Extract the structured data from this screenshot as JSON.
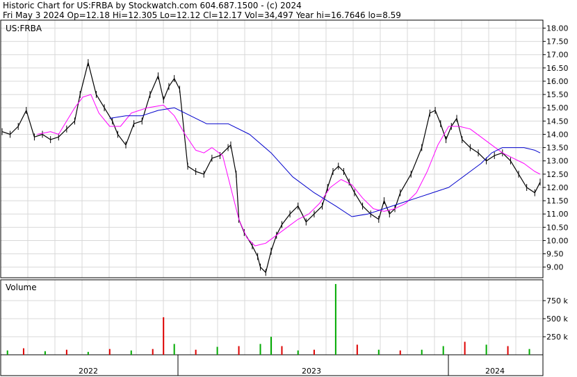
{
  "header": {
    "line1": "Historic Chart for US:FRBA by Stockwatch.com 604.687.1500 - (c) 2024",
    "line2": "Fri May  3 2024   Op=12.18   Hi=12.305   Lo=12.12   Cl=12.17   Vol=34,497   Year hi=16.7646   lo=8.59"
  },
  "chart_data": {
    "type": "line",
    "symbol_label": "US:FRBA",
    "volume_label": "Volume",
    "x_axis_labels": [
      "2022",
      "2023",
      "2024"
    ],
    "price_axis": {
      "ylim": [
        8.6,
        18.3
      ],
      "ticks": [
        "18.00",
        "17.50",
        "17.00",
        "16.50",
        "16.00",
        "15.50",
        "15.00",
        "14.50",
        "14.00",
        "13.50",
        "13.00",
        "12.50",
        "12.00",
        "11.50",
        "11.00",
        "10.50",
        "10.00",
        "9.50",
        "9.00"
      ]
    },
    "volume_axis": {
      "ylim": [
        0,
        1000000
      ],
      "ticks": [
        "750 k",
        "500 k",
        "250 k"
      ]
    },
    "grid": true,
    "colors": {
      "price_bars": "#000000",
      "ma_short": "#ff00ff",
      "ma_long": "#0000cc",
      "volume_up": "#00aa00",
      "volume_down": "#dd0000",
      "grid": "#d8d8d8"
    },
    "series": [
      {
        "kind": "price",
        "x": [
          0,
          0.015,
          0.03,
          0.045,
          0.06,
          0.075,
          0.09,
          0.105,
          0.12,
          0.135,
          0.145,
          0.16,
          0.175,
          0.19,
          0.205,
          0.215,
          0.23,
          0.245,
          0.26,
          0.275,
          0.29,
          0.3,
          0.31,
          0.32,
          0.33,
          0.345,
          0.36,
          0.375,
          0.39,
          0.405,
          0.42,
          0.425,
          0.435,
          0.44,
          0.45,
          0.465,
          0.475,
          0.48,
          0.49,
          0.5,
          0.51,
          0.52,
          0.535,
          0.55,
          0.565,
          0.58,
          0.595,
          0.605,
          0.615,
          0.625,
          0.635,
          0.645,
          0.655,
          0.67,
          0.685,
          0.7,
          0.71,
          0.72,
          0.73,
          0.74,
          0.76,
          0.78,
          0.795,
          0.805,
          0.815,
          0.825,
          0.835,
          0.845,
          0.855,
          0.87,
          0.885,
          0.9,
          0.915,
          0.93,
          0.945,
          0.96,
          0.975,
          0.99,
          1.0
        ],
        "values": [
          14.1,
          14.0,
          14.3,
          14.9,
          13.9,
          14.0,
          13.8,
          13.9,
          14.2,
          14.5,
          15.5,
          16.7,
          15.5,
          15.0,
          14.5,
          14.0,
          13.6,
          14.4,
          14.5,
          15.5,
          16.2,
          15.3,
          15.8,
          16.1,
          15.7,
          12.8,
          12.6,
          12.5,
          13.1,
          13.2,
          13.5,
          13.6,
          12.5,
          10.8,
          10.3,
          9.8,
          9.4,
          9.0,
          8.8,
          9.6,
          10.2,
          10.6,
          11.0,
          11.3,
          10.7,
          11.0,
          11.3,
          12.0,
          12.6,
          12.8,
          12.6,
          12.2,
          11.8,
          11.3,
          11.0,
          10.8,
          11.5,
          11.0,
          11.2,
          11.8,
          12.5,
          13.5,
          14.8,
          14.9,
          14.4,
          13.8,
          14.3,
          14.6,
          13.8,
          13.5,
          13.3,
          13.0,
          13.2,
          13.3,
          13.0,
          12.5,
          12.0,
          11.8,
          12.2
        ]
      },
      {
        "kind": "ma_short",
        "x": [
          0.065,
          0.09,
          0.105,
          0.12,
          0.135,
          0.15,
          0.165,
          0.18,
          0.2,
          0.22,
          0.24,
          0.27,
          0.3,
          0.32,
          0.34,
          0.36,
          0.375,
          0.39,
          0.41,
          0.425,
          0.44,
          0.455,
          0.47,
          0.49,
          0.51,
          0.53,
          0.55,
          0.57,
          0.59,
          0.61,
          0.63,
          0.65,
          0.67,
          0.69,
          0.71,
          0.73,
          0.75,
          0.77,
          0.79,
          0.81,
          0.83,
          0.85,
          0.87,
          0.89,
          0.91,
          0.93,
          0.95,
          0.97,
          0.99,
          1.0
        ],
        "values": [
          14.0,
          14.1,
          14.0,
          14.5,
          15.0,
          15.4,
          15.5,
          14.8,
          14.3,
          14.3,
          14.8,
          15.0,
          15.1,
          14.7,
          14.0,
          13.4,
          13.3,
          13.5,
          13.2,
          12.0,
          10.8,
          10.1,
          9.8,
          9.9,
          10.2,
          10.5,
          10.8,
          11.0,
          11.4,
          12.0,
          12.3,
          12.1,
          11.6,
          11.2,
          11.1,
          11.2,
          11.4,
          11.8,
          12.6,
          13.6,
          14.3,
          14.3,
          14.2,
          13.9,
          13.6,
          13.3,
          13.1,
          12.9,
          12.6,
          12.5
        ]
      },
      {
        "kind": "ma_long",
        "x": [
          0.2,
          0.23,
          0.26,
          0.29,
          0.32,
          0.35,
          0.38,
          0.42,
          0.46,
          0.5,
          0.54,
          0.58,
          0.62,
          0.65,
          0.68,
          0.71,
          0.74,
          0.77,
          0.8,
          0.83,
          0.85,
          0.87,
          0.89,
          0.91,
          0.93,
          0.95,
          0.97,
          0.99,
          1.0
        ],
        "values": [
          14.6,
          14.7,
          14.7,
          14.9,
          15.0,
          14.7,
          14.4,
          14.4,
          14.0,
          13.3,
          12.4,
          11.8,
          11.3,
          10.9,
          11.0,
          11.2,
          11.4,
          11.6,
          11.8,
          12.0,
          12.3,
          12.6,
          12.9,
          13.3,
          13.5,
          13.5,
          13.5,
          13.4,
          13.3
        ]
      }
    ],
    "volume_series": {
      "x": [
        0.01,
        0.04,
        0.08,
        0.12,
        0.16,
        0.2,
        0.24,
        0.28,
        0.3,
        0.32,
        0.36,
        0.4,
        0.44,
        0.48,
        0.5,
        0.52,
        0.55,
        0.58,
        0.62,
        0.66,
        0.7,
        0.74,
        0.78,
        0.82,
        0.86,
        0.9,
        0.94,
        0.98
      ],
      "values": [
        60000,
        90000,
        50000,
        70000,
        40000,
        80000,
        60000,
        80000,
        520000,
        150000,
        70000,
        110000,
        120000,
        150000,
        250000,
        120000,
        60000,
        70000,
        980000,
        140000,
        70000,
        60000,
        70000,
        120000,
        180000,
        140000,
        120000,
        80000
      ],
      "up": [
        true,
        false,
        true,
        false,
        true,
        false,
        true,
        false,
        false,
        true,
        false,
        true,
        false,
        true,
        true,
        false,
        true,
        false,
        true,
        false,
        true,
        false,
        true,
        true,
        false,
        true,
        false,
        true
      ]
    }
  }
}
